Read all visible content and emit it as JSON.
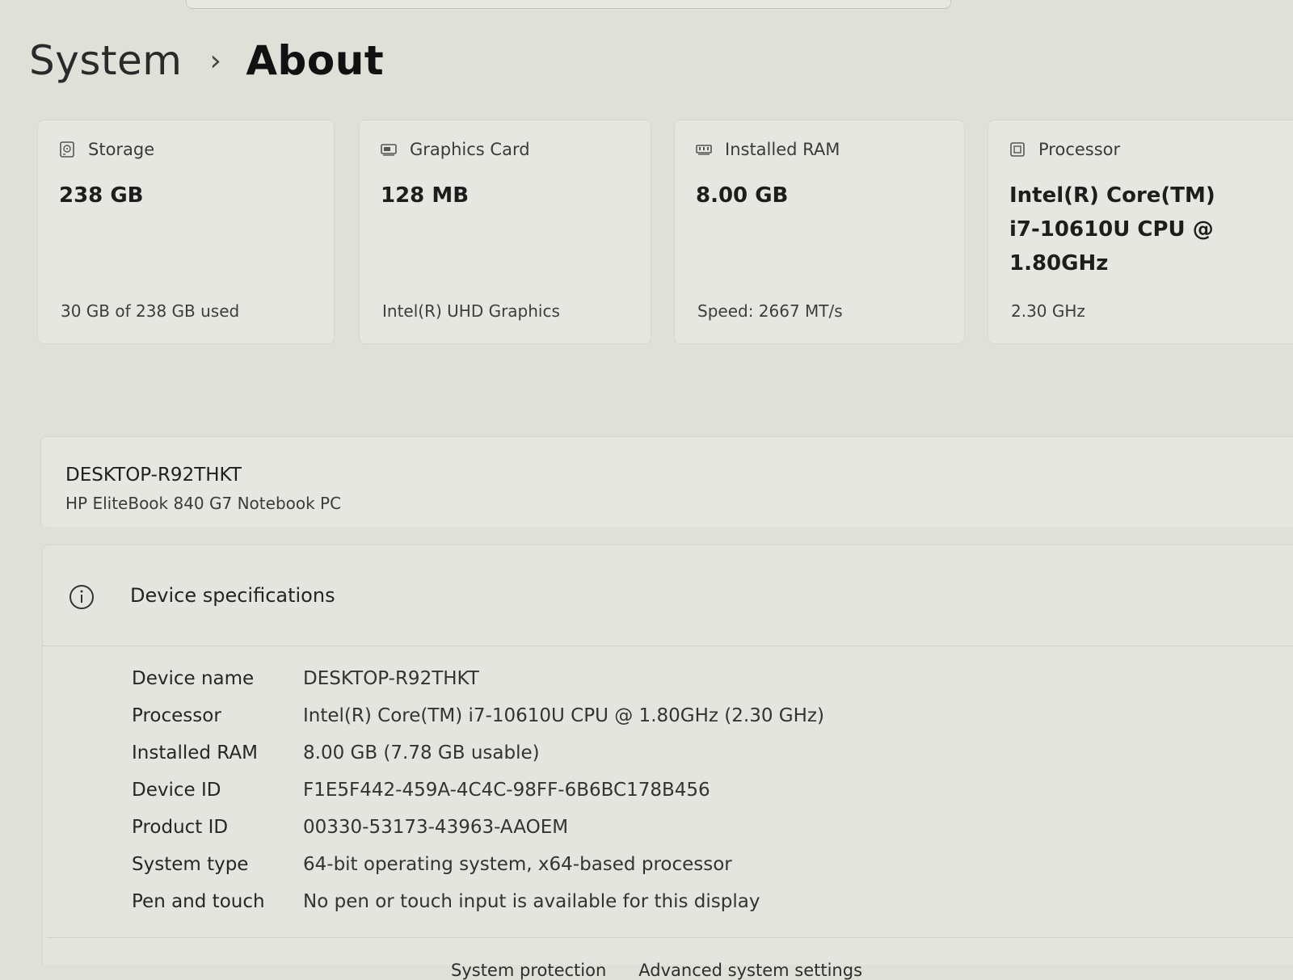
{
  "breadcrumb": {
    "parent": "System",
    "separator": "›",
    "current": "About"
  },
  "cards": [
    {
      "icon": "storage-icon",
      "title": "Storage",
      "value": "238 GB",
      "sub": "30 GB of 238 GB used"
    },
    {
      "icon": "graphics-card-icon",
      "title": "Graphics Card",
      "value": "128 MB",
      "sub": "Intel(R) UHD Graphics"
    },
    {
      "icon": "ram-icon",
      "title": "Installed RAM",
      "value": "8.00 GB",
      "sub": "Speed: 2667 MT/s"
    },
    {
      "icon": "processor-icon",
      "title": "Processor",
      "value_lines": [
        "Intel(R) Core(TM)",
        "i7-10610U CPU @",
        "1.80GHz"
      ],
      "sub": "2.30 GHz"
    }
  ],
  "device": {
    "name": "DESKTOP-R92THKT",
    "model": "HP EliteBook 840 G7 Notebook PC"
  },
  "specs": {
    "icon": "info-icon",
    "title": "Device specifications",
    "rows": [
      {
        "label": "Device name",
        "value": "DESKTOP-R92THKT"
      },
      {
        "label": "Processor",
        "value": "Intel(R) Core(TM) i7-10610U CPU @ 1.80GHz (2.30 GHz)"
      },
      {
        "label": "Installed RAM",
        "value": "8.00 GB (7.78 GB usable)"
      },
      {
        "label": "Device ID",
        "value": "F1E5F442-459A-4C4C-98FF-6B6BC178B456"
      },
      {
        "label": "Product ID",
        "value": "00330-53173-43963-AAOEM"
      },
      {
        "label": "System type",
        "value": "64-bit operating system, x64-based processor"
      },
      {
        "label": "Pen and touch",
        "value": "No pen or touch input is available for this display"
      }
    ]
  },
  "bottom_links": {
    "system_protection": "System protection",
    "advanced_settings": "Advanced system settings"
  }
}
